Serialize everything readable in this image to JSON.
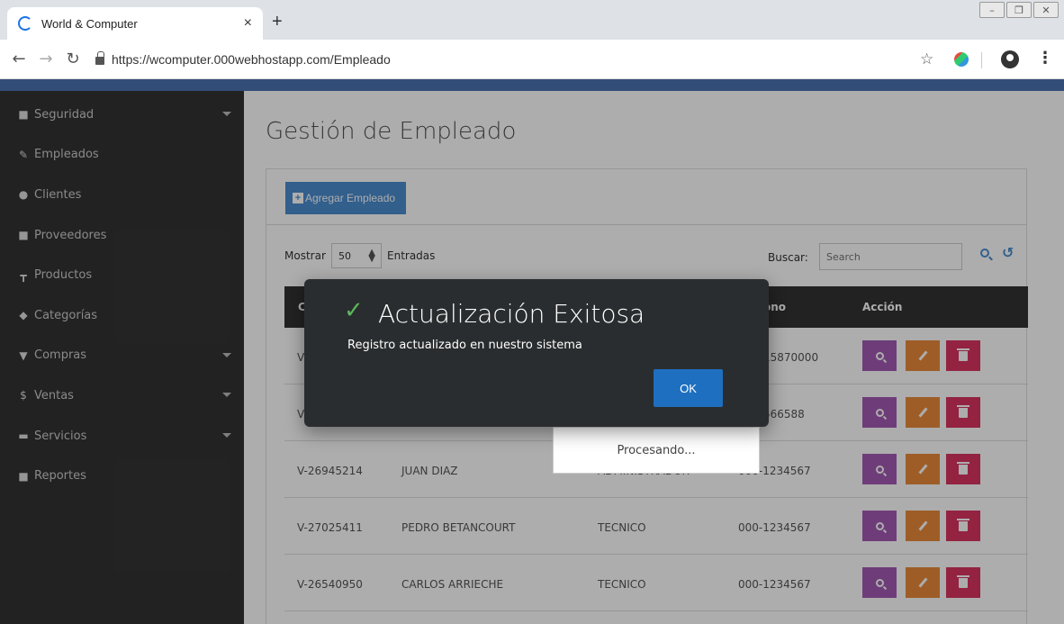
{
  "browser": {
    "tab_title": "World & Computer",
    "tab_close": "×",
    "new_tab": "+",
    "url": "https://wcomputer.000webhostapp.com/Empleado"
  },
  "sidebar": {
    "items": [
      {
        "label": "Seguridad",
        "icon": "lock-icon"
      },
      {
        "label": "Empleados",
        "icon": "wrench-icon"
      },
      {
        "label": "Clientes",
        "icon": "users-icon"
      },
      {
        "label": "Proveedores",
        "icon": "truck-icon"
      },
      {
        "label": "Productos",
        "icon": "sitemap-icon"
      },
      {
        "label": "Categorías",
        "icon": "tag-icon"
      },
      {
        "label": "Compras",
        "icon": "cart-icon"
      },
      {
        "label": "Ventas",
        "icon": "dollar-icon"
      },
      {
        "label": "Servicios",
        "icon": "handshake-icon"
      },
      {
        "label": "Reportes",
        "icon": "briefcase-icon"
      }
    ]
  },
  "main": {
    "title": "Gestión de Empleado",
    "add_button": "Agregar Empleado",
    "show_label": "Mostrar",
    "show_value": "50",
    "entries_label": "Entradas",
    "search_label": "Buscar:",
    "search_placeholder": "Search",
    "table": {
      "headers": [
        "C",
        "ono",
        "Acción"
      ],
      "rows": [
        {
          "cedula": "V-",
          "nombre": "",
          "cargo": "",
          "telefono": "15870000"
        },
        {
          "cedula": "V",
          "nombre": "",
          "cargo": "",
          "telefono": "566588"
        },
        {
          "cedula": "V-26945214",
          "nombre": "JUAN DIAZ",
          "cargo": "ADMINISTRADOR",
          "telefono": "000-1234567"
        },
        {
          "cedula": "V-27025411",
          "nombre": "PEDRO BETANCOURT",
          "cargo": "TECNICO",
          "telefono": "000-1234567"
        },
        {
          "cedula": "V-26540950",
          "nombre": "CARLOS ARRIECHE",
          "cargo": "TECNICO",
          "telefono": "000-1234567"
        }
      ]
    }
  },
  "processing": "Procesando...",
  "modal": {
    "title": "Actualización Exitosa",
    "message": "Registro actualizado en nuestro sistema",
    "ok": "OK"
  },
  "colors": {
    "sidebar_bg": "#333333",
    "topnav": "#4a72b2",
    "primary": "#4a8ccf",
    "view_btn": "#a35bb3",
    "edit_btn": "#e9893a",
    "delete_btn": "#d93461",
    "success": "#5cb85c"
  }
}
